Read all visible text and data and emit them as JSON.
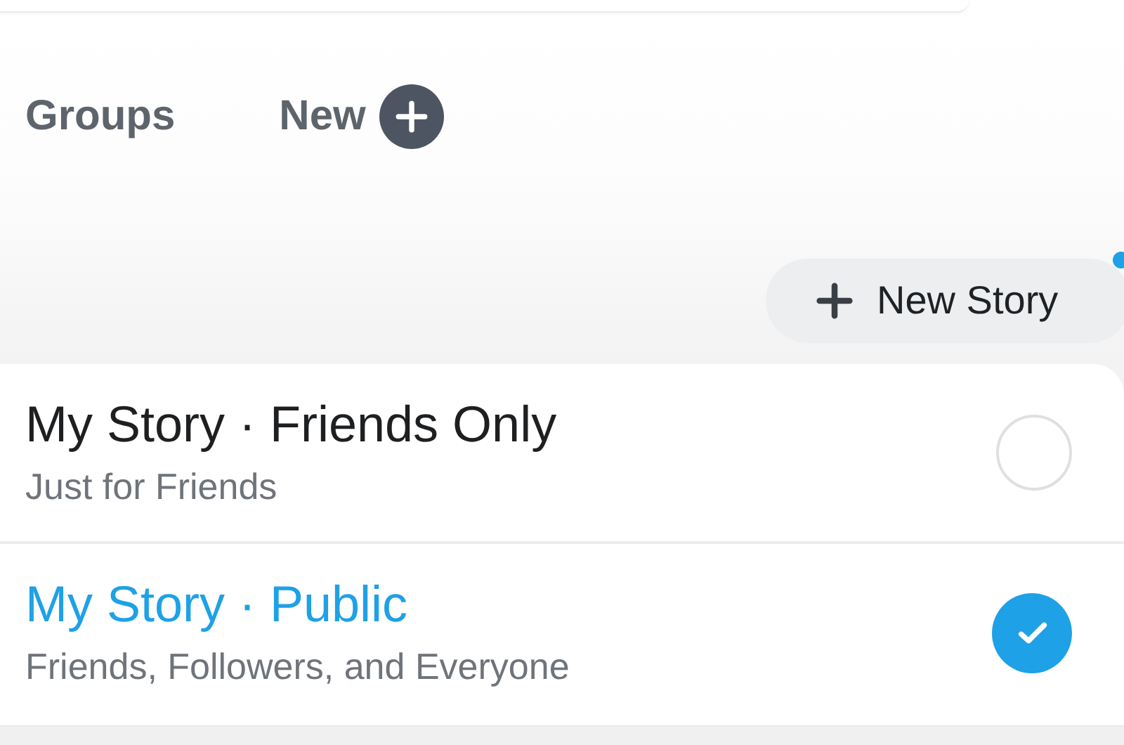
{
  "tabs": [
    {
      "label": "Groups"
    },
    {
      "label": "New"
    }
  ],
  "new_story_button": {
    "label": "New Story",
    "notification": true
  },
  "stories": [
    {
      "title": "My Story · Friends Only",
      "subtitle": "Just for Friends",
      "selected": false
    },
    {
      "title": "My Story · Public",
      "subtitle": "Friends, Followers, and Everyone",
      "selected": true
    }
  ]
}
